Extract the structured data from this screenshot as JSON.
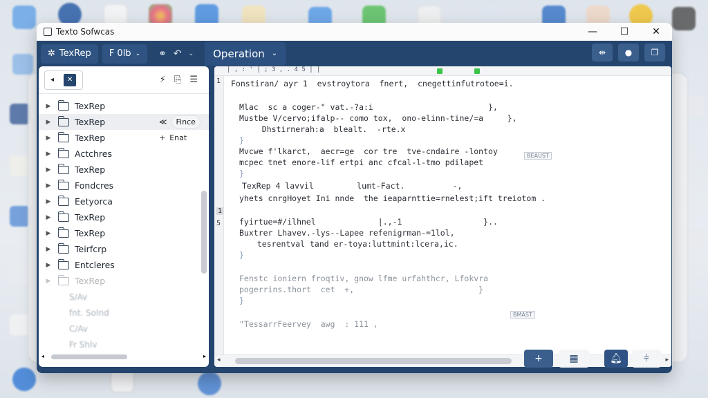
{
  "window": {
    "title": "Texto Sofwcas",
    "minimize_glyph": "—",
    "maximize_glyph": "☐",
    "close_glyph": "✕"
  },
  "toolbar": {
    "app_button_label": "TexRep",
    "file_menu_label": "F 0lb",
    "operation_label": "Operation"
  },
  "sidebar": {
    "items": [
      {
        "label": "TexRep",
        "icon": "folder-icon"
      },
      {
        "label": "TexRep",
        "icon": "folder-icon",
        "selected": true,
        "ctx": "Fince"
      },
      {
        "label": "TexRep",
        "icon": "folder-icon",
        "ctx": "Enat"
      },
      {
        "label": "Actchres",
        "icon": "folder-icon"
      },
      {
        "label": "TexRep",
        "icon": "folder-icon"
      },
      {
        "label": "Fondcres",
        "icon": "folder-icon"
      },
      {
        "label": "Eetyorca",
        "icon": "document-icon"
      },
      {
        "label": "TexRep",
        "icon": "folder-icon"
      },
      {
        "label": "TexRep",
        "icon": "document-icon"
      },
      {
        "label": "Teirfcrp",
        "icon": "folder-icon"
      },
      {
        "label": "Entcleres",
        "icon": "list-icon"
      },
      {
        "label": "TexRep",
        "icon": "folder-icon",
        "faded": true
      }
    ],
    "ghost_items": [
      "S/Av",
      "fnt. Solnd",
      "C/Av",
      "Fr Shlv"
    ]
  },
  "editor": {
    "ruler_text": "  |  ,  :  '  |  ;  3  ,  .  4  5  |     |",
    "gutter": [
      "1",
      "1",
      "5"
    ],
    "lines": [
      "Fonstiran/ ayr 1  evstroytora  fnert,  cnegettinfutrotoe=i.",
      "Mlac  sc a coger-\" vat.-?a:i                        },",
      "Mustbe V/cervo;ifalp-- como tox,  ono-elinn-tine/=a     },",
      "   Dhstirnerah:a  blealt.  -rte.x",
      "}",
      "Mvcwe f'lkarct,  aecr=ge  cor tre  tve-cndaire -lontoy",
      "mcpec tnet enore-lif ertpi anc cfcal-l-tmo pdilapet",
      "}",
      "TexRep 4 lavvil         lumt-Fact.          -,",
      "yhets cnrgHoyet Ini nnde  the ieaparnttie=rnelest;ift treiotom .",
      "fyirtue=#/ilhnel             |.,-1                 }..",
      "Buxtrer Lhavev.-lys--Lapee refenigrman-=1lol,",
      "  tesrentval tand er-toya:luttmint:lcera,ic.",
      "}",
      "Fenstc ioniern froqtiv, gnow lfme urfahthcr, Lfokvra",
      "pogerrins.thort  cet  +,                          }",
      "}",
      "\"TessarrFeervey  awg  : 111 ,"
    ],
    "tags": [
      "BEAUST",
      "BMAST"
    ]
  },
  "statusbar": {
    "add_glyph": "+"
  },
  "colors": {
    "chrome": "#24456d",
    "accent_green": "#3cc44a"
  }
}
